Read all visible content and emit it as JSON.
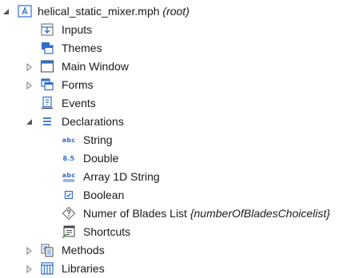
{
  "tree": {
    "root": {
      "label": "helical_static_mixer.mph",
      "suffix": "(root)",
      "icon": "application-icon"
    },
    "inputs": {
      "label": "Inputs",
      "icon": "inputs-icon"
    },
    "themes": {
      "label": "Themes",
      "icon": "themes-icon"
    },
    "main_window": {
      "label": "Main Window",
      "icon": "window-icon"
    },
    "forms": {
      "label": "Forms",
      "icon": "forms-icon"
    },
    "events": {
      "label": "Events",
      "icon": "events-icon"
    },
    "declarations": {
      "label": "Declarations",
      "icon": "declarations-icon"
    },
    "string": {
      "label": "String",
      "icon": "string-icon",
      "icon_text": "abc"
    },
    "double": {
      "label": "Double",
      "icon": "double-icon",
      "icon_text": "8.5"
    },
    "array": {
      "label": "Array 1D String",
      "icon": "array-string-icon",
      "icon_text": "abc"
    },
    "boolean": {
      "label": "Boolean",
      "icon": "boolean-icon"
    },
    "choice_list": {
      "label": "Numer of Blades List",
      "suffix": "{numberOfBladesChoicelist}",
      "icon": "choice-list-icon"
    },
    "shortcuts": {
      "label": "Shortcuts",
      "icon": "shortcuts-icon"
    },
    "methods": {
      "label": "Methods",
      "icon": "methods-icon"
    },
    "libraries": {
      "label": "Libraries",
      "icon": "libraries-icon"
    }
  },
  "colors": {
    "accent": "#2f6fc9",
    "toggle": "#7a7a7a",
    "text": "#1a1a1a"
  }
}
